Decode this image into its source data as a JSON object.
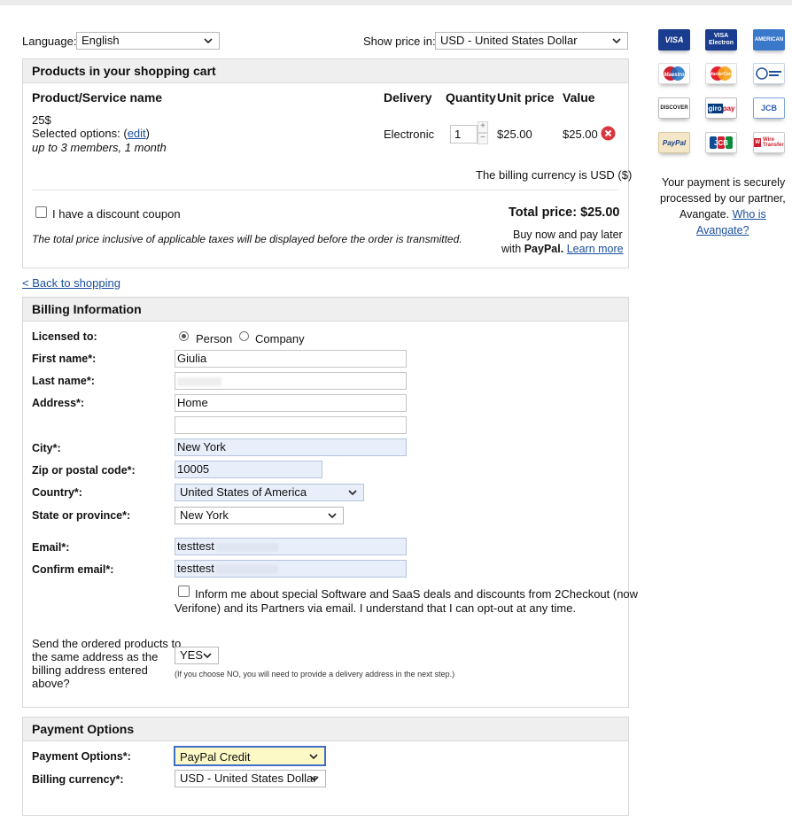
{
  "top": {
    "language_label": "Language:",
    "language_value": "English",
    "currency_label": "Show price in:",
    "currency_value": "USD - United States Dollar"
  },
  "cart": {
    "title": "Products in your shopping cart",
    "col_product": "Product/Service name",
    "col_delivery": "Delivery",
    "col_quantity": "Quantity",
    "col_unit_price": "Unit price",
    "col_value": "Value",
    "product_name": "25$",
    "selected_options_prefix": "Selected options: (",
    "edit_link": "edit",
    "selected_options_suffix": ")",
    "options_detail": "up to 3 members, 1 month",
    "delivery": "Electronic",
    "quantity": "1",
    "unit_price": "$25.00",
    "value": "$25.00",
    "billing_currency_note": "The billing currency is USD ($)",
    "coupon_label": "I have a discount coupon",
    "total_price": "Total price: $25.00",
    "tax_note": "The total price inclusive of applicable taxes will be displayed before the order is transmitted.",
    "paypal_line1": "Buy now and pay later",
    "paypal_with": "with",
    "paypal_brand": "PayPal.",
    "learn_more": "Learn more"
  },
  "back_link": "< Back to shopping",
  "billing": {
    "title": "Billing Information",
    "licensed_to_label": "Licensed to:",
    "person_label": "Person",
    "company_label": "Company",
    "first_name_label": "First name*:",
    "first_name_value": "Giulia",
    "last_name_label": "Last name*:",
    "address_label": "Address*:",
    "address_value": "Home",
    "city_label": "City*:",
    "city_value": "New York",
    "zip_label": "Zip or postal code*:",
    "zip_value": "10005",
    "country_label": "Country*:",
    "country_value": "United States of America",
    "state_label": "State or province*:",
    "state_value": "New York",
    "email_label": "Email*:",
    "email_value": "testtest",
    "confirm_email_label": "Confirm email*:",
    "confirm_email_value": "testtest",
    "newsletter_text_line1": "Inform me about special Software and SaaS deals and discounts from 2Checkout (now",
    "newsletter_text_line2": "Verifone) and its Partners via email. I understand that I can opt-out at any time.",
    "same_address_line1": "Send the ordered products to",
    "same_address_line2": "the same address as the",
    "same_address_line3": "billing address entered",
    "same_address_line4": "above?",
    "same_address_value": "YES",
    "same_address_note": "(If you choose NO, you will need to provide a delivery address in the next step.)"
  },
  "payment": {
    "title": "Payment Options",
    "options_label": "Payment Options*:",
    "options_value": "PayPal Credit",
    "currency_label": "Billing currency*:",
    "currency_value": "USD - United States Dollar"
  },
  "sidebar": {
    "cards": [
      "VISA",
      "VISA Electron",
      "AMEX",
      "Maestro",
      "MasterCard",
      "Diners",
      "DISCOVER",
      "giropay",
      "JCB alt",
      "PayPal",
      "JCB",
      "Wire Transfer"
    ],
    "secure_line1": "Your payment is securely",
    "secure_line2": "processed by our partner,",
    "secure_line3": "Avangate.",
    "who_is_link": "Who is",
    "avangate_link": "Avangate?"
  },
  "colors": {
    "accent_link": "#1a4f9c",
    "payment_highlight": "#fdf9c6",
    "autofill": "#e8effa",
    "remove_icon": "#d9363e"
  }
}
